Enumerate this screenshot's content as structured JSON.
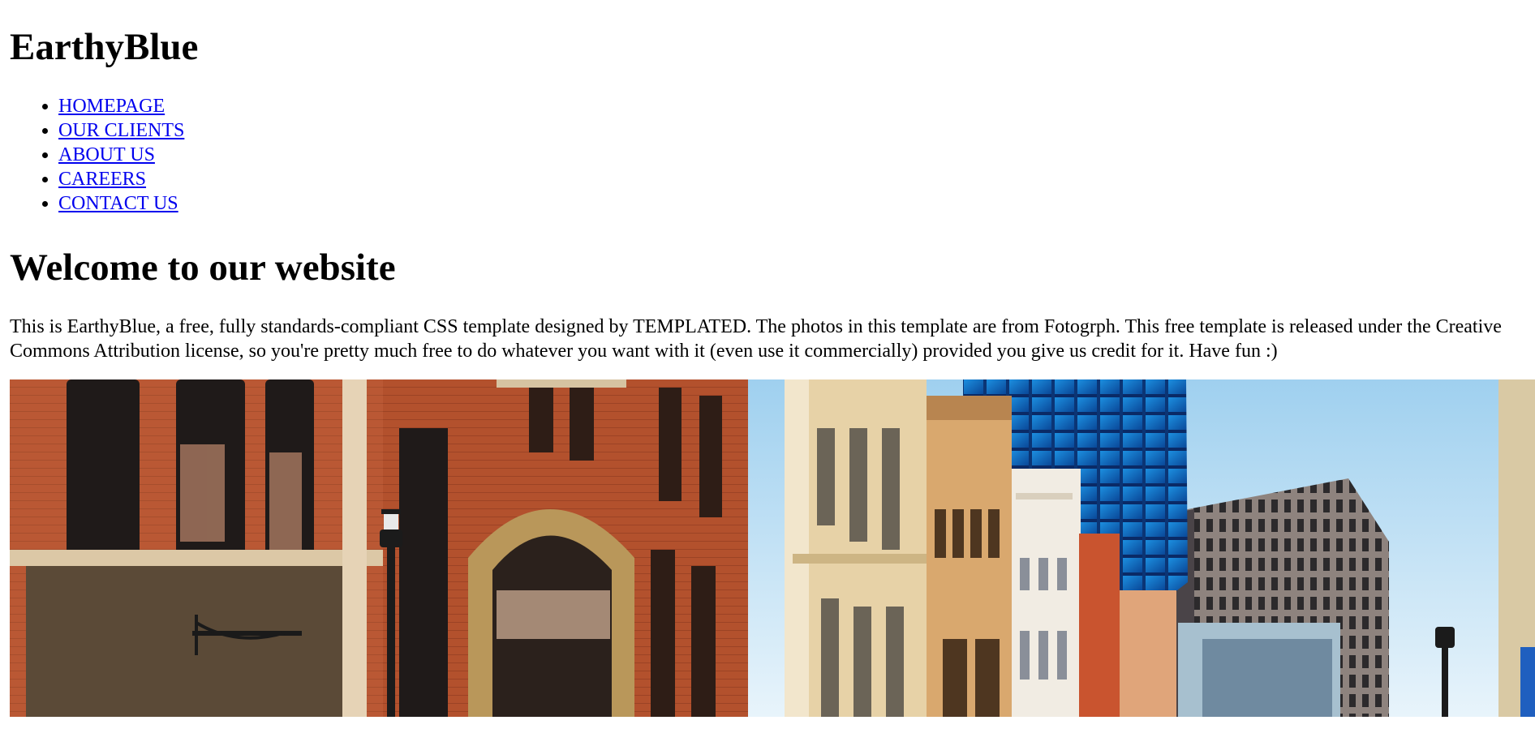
{
  "site": {
    "title": "EarthyBlue"
  },
  "nav": {
    "items": [
      {
        "label": "HOMEPAGE"
      },
      {
        "label": "OUR CLIENTS"
      },
      {
        "label": "ABOUT US"
      },
      {
        "label": "CAREERS"
      },
      {
        "label": "CONTACT US"
      }
    ]
  },
  "main": {
    "heading": "Welcome to our website",
    "intro": "This is EarthyBlue, a free, fully standards-compliant CSS template designed by TEMPLATED. The photos in this template are from Fotogrph. This free template is released under the Creative Commons Attribution license, so you're pretty much free to do whatever you want with it (even use it commercially) provided you give us credit for it. Have fun :)"
  },
  "colors": {
    "link": "#0000ee",
    "text": "#000000",
    "background": "#ffffff"
  }
}
